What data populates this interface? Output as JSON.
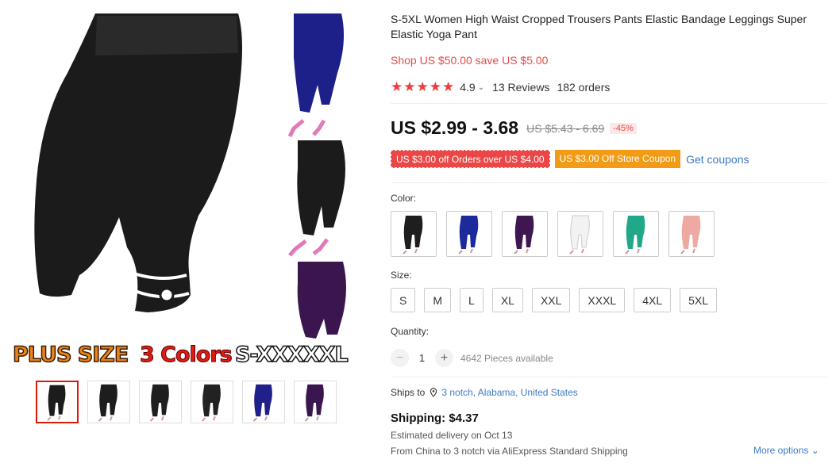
{
  "product": {
    "title": "S-5XL Women High Waist Cropped Trousers Pants Elastic Bandage Leggings Super Elastic Yoga Pant",
    "shop_promo": "Shop US $50.00 save US $5.00",
    "stars": "★★★★★",
    "rating": "4.9",
    "reviews": "13 Reviews",
    "orders": "182 orders",
    "price": "US $2.99 - 3.68",
    "original_price": "US $5.43 - 6.69",
    "discount": "-45%"
  },
  "gallery": {
    "banner_plus": "PLUS SIZE",
    "banner_colors": "3 Colors",
    "banner_size": "S-XXXXXL",
    "thumb_colors": [
      "#1c1c1c",
      "#1d1d1d",
      "#1f1f1f",
      "#222222",
      "#20208a",
      "#3a154e"
    ]
  },
  "coupons": {
    "coupon1": "US $3.00 off Orders over US $4.00",
    "coupon2": "US $3.00 Off Store Coupon",
    "get_coupons": "Get coupons"
  },
  "color": {
    "label": "Color:",
    "options": [
      "#1e1e1e",
      "#1c2a9a",
      "#3e1650",
      "#f2f2f2",
      "#21a88a",
      "#eeaaa2"
    ]
  },
  "size": {
    "label": "Size:",
    "options": [
      "S",
      "M",
      "L",
      "XL",
      "XXL",
      "XXXL",
      "4XL",
      "5XL"
    ]
  },
  "quantity": {
    "label": "Quantity:",
    "minus": "−",
    "value": "1",
    "plus": "+",
    "available": "4642 Pieces available"
  },
  "shipping": {
    "ships_to_label": "Ships to",
    "location": "3 notch, Alabama, United States",
    "cost": "Shipping: $4.37",
    "delivery": "Estimated delivery on Oct 13",
    "route": "From China to 3 notch via AliExpress Standard Shipping",
    "more_options": "More options",
    "more_chevron": "⌄"
  }
}
